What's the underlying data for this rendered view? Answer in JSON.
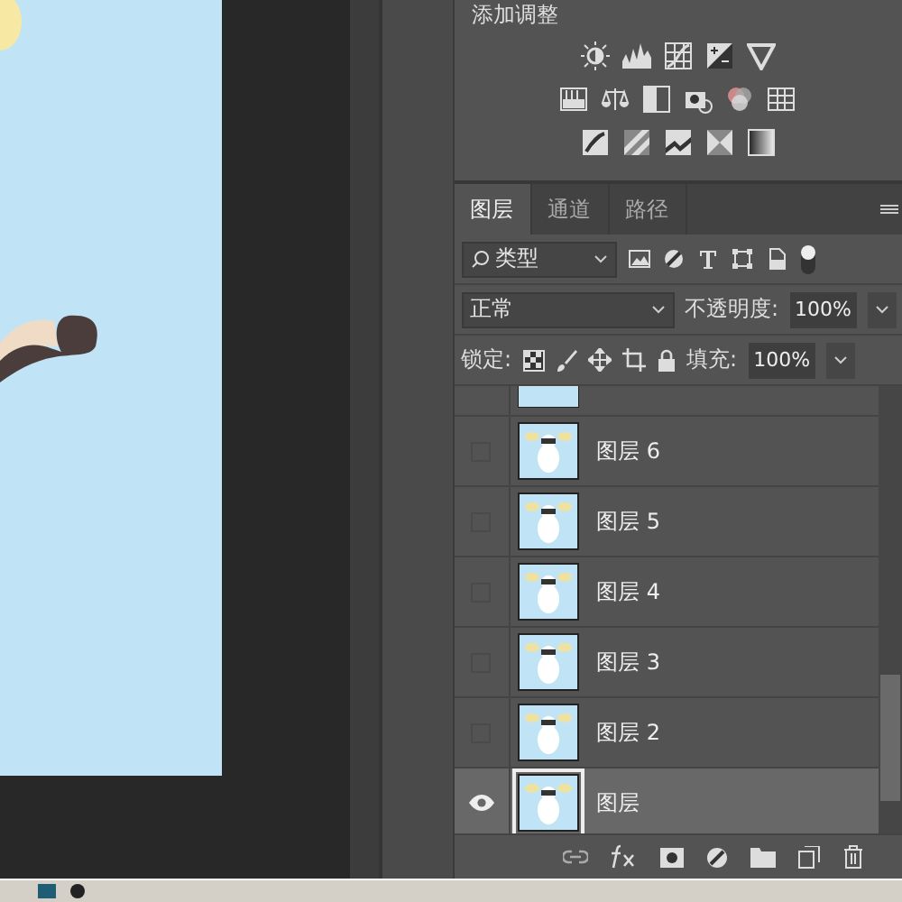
{
  "adjustments": {
    "title": "添加调整"
  },
  "layers_panel": {
    "tabs": [
      {
        "label": "图层",
        "selected": true
      },
      {
        "label": "通道",
        "selected": false
      },
      {
        "label": "路径",
        "selected": false
      }
    ],
    "filter": {
      "value": "类型"
    },
    "blend": {
      "value": "正常"
    },
    "opacity": {
      "label": "不透明度:",
      "value": "100%"
    },
    "lock": {
      "label": "锁定:"
    },
    "fill": {
      "label": "填充:",
      "value": "100%"
    },
    "layers": [
      {
        "name": "图层 6",
        "visible": false,
        "selected": false
      },
      {
        "name": "图层 5",
        "visible": false,
        "selected": false
      },
      {
        "name": "图层 4",
        "visible": false,
        "selected": false
      },
      {
        "name": "图层 3",
        "visible": false,
        "selected": false
      },
      {
        "name": "图层 2",
        "visible": false,
        "selected": false
      },
      {
        "name": "图层",
        "visible": true,
        "selected": true
      }
    ]
  }
}
